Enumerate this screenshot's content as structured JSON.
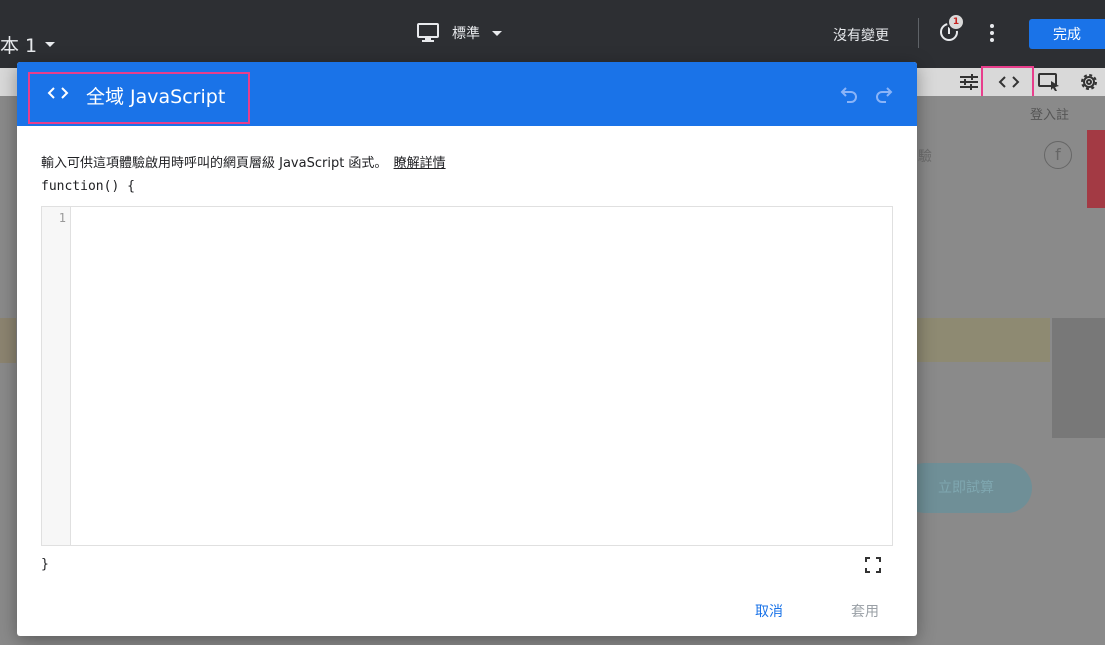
{
  "topbar": {
    "variant_label": "本 1",
    "device_label": "標準",
    "status_text": "沒有變更",
    "alert_count": "1",
    "done_label": "完成"
  },
  "dialog": {
    "title": "全域 JavaScript",
    "description": "輸入可供這項體驗啟用時呼叫的網頁層級 JavaScript 函式。",
    "learn_more": "瞭解詳情",
    "function_open": "function() {",
    "line_number": "1",
    "code": "",
    "function_close": "}",
    "cancel_label": "取消",
    "apply_label": "套用"
  },
  "background": {
    "login_text": "登入註",
    "nav_text": "驗",
    "fb_glyph": "f",
    "cta_text": "立即試算"
  },
  "colors": {
    "accent": "#1a73e8",
    "highlight": "#e83e8c",
    "topbar": "#2d2f33"
  },
  "icons": [
    "monitor-icon",
    "code-icon",
    "undo-icon",
    "redo-icon",
    "fullscreen-icon",
    "tune-icon",
    "select-element-icon",
    "gear-icon",
    "alert-icon",
    "more-vert-icon"
  ]
}
